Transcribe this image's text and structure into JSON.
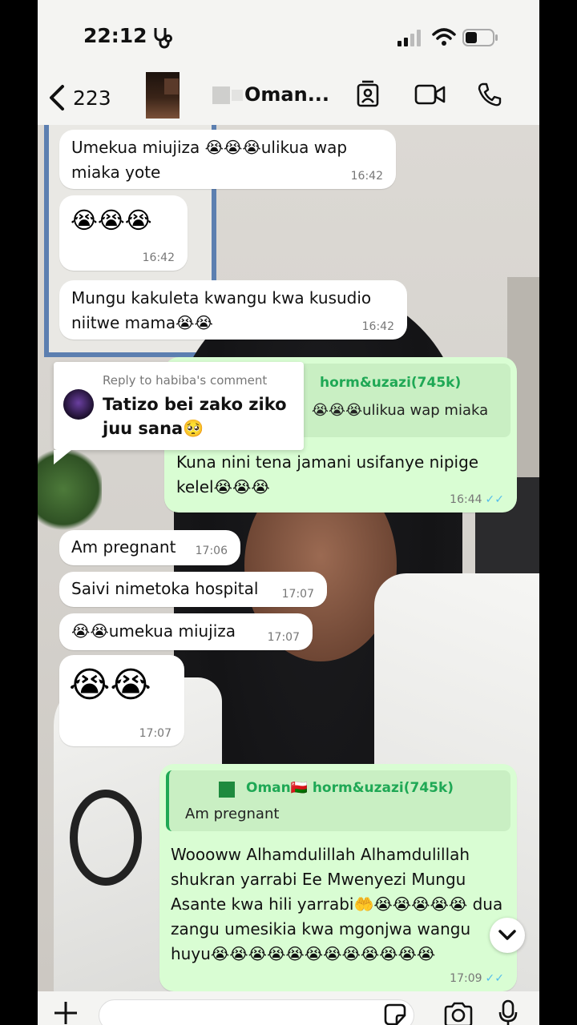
{
  "status_bar": {
    "time": "22:12",
    "icons": [
      "stethoscope-icon",
      "cellular-signal-icon",
      "wifi-icon",
      "battery-icon"
    ]
  },
  "header": {
    "back_count": "223",
    "contact_name": "Oman...",
    "icons": [
      "contact-card-icon",
      "video-call-icon",
      "voice-call-icon"
    ]
  },
  "reply_card": {
    "label": "Reply to habiba's comment",
    "text": "Tatizo bei zako ziko juu sana🥺"
  },
  "messages": [
    {
      "text": "Umekua miujiza 😭😭😭ulikua wap miaka yote",
      "time": "16:42"
    },
    {
      "text": "😭😭😭",
      "time": "16:42"
    },
    {
      "text": "Mungu kakuleta kwangu kwa kusudio niitwe mama😭😭",
      "time": "16:42"
    },
    {
      "quote_author": "horm&uzazi(745k)",
      "quote_text": "😭😭😭ulikua wap miaka",
      "text": "Kuna nini tena jamani usifanye nipige kelel😭😭😭",
      "time": "16:44",
      "status": "✓✓"
    },
    {
      "text": "Am pregnant",
      "time": "17:06"
    },
    {
      "text": "Saivi nimetoka hospital",
      "time": "17:07"
    },
    {
      "text": "😭😭umekua miujiza",
      "time": "17:07"
    },
    {
      "text": "😭😭",
      "time": "17:07"
    },
    {
      "quote_author": "Oman🇴🇲 horm&uzazi(745k)",
      "quote_text": "Am pregnant",
      "text": "Woooww Alhamdulillah Alhamdulillah shukran yarrabi Ee Mwenyezi Mungu Asante kwa hili yarrabi🤲😭😭😭😭😭 dua zangu umesikia kwa mgonjwa wangu huyu😭😭😭😭😭😭😭😭😭😭😭😭",
      "time": "17:09",
      "status": "✓✓"
    }
  ],
  "input_bar": {
    "icons": [
      "plus-icon",
      "sticker-icon",
      "camera-icon",
      "microphone-icon"
    ]
  },
  "colors": {
    "incoming_bubble": "#ffffff",
    "outgoing_bubble": "#d9fdd3",
    "accent_green": "#1fa855",
    "read_ticks": "#53bdeb"
  }
}
